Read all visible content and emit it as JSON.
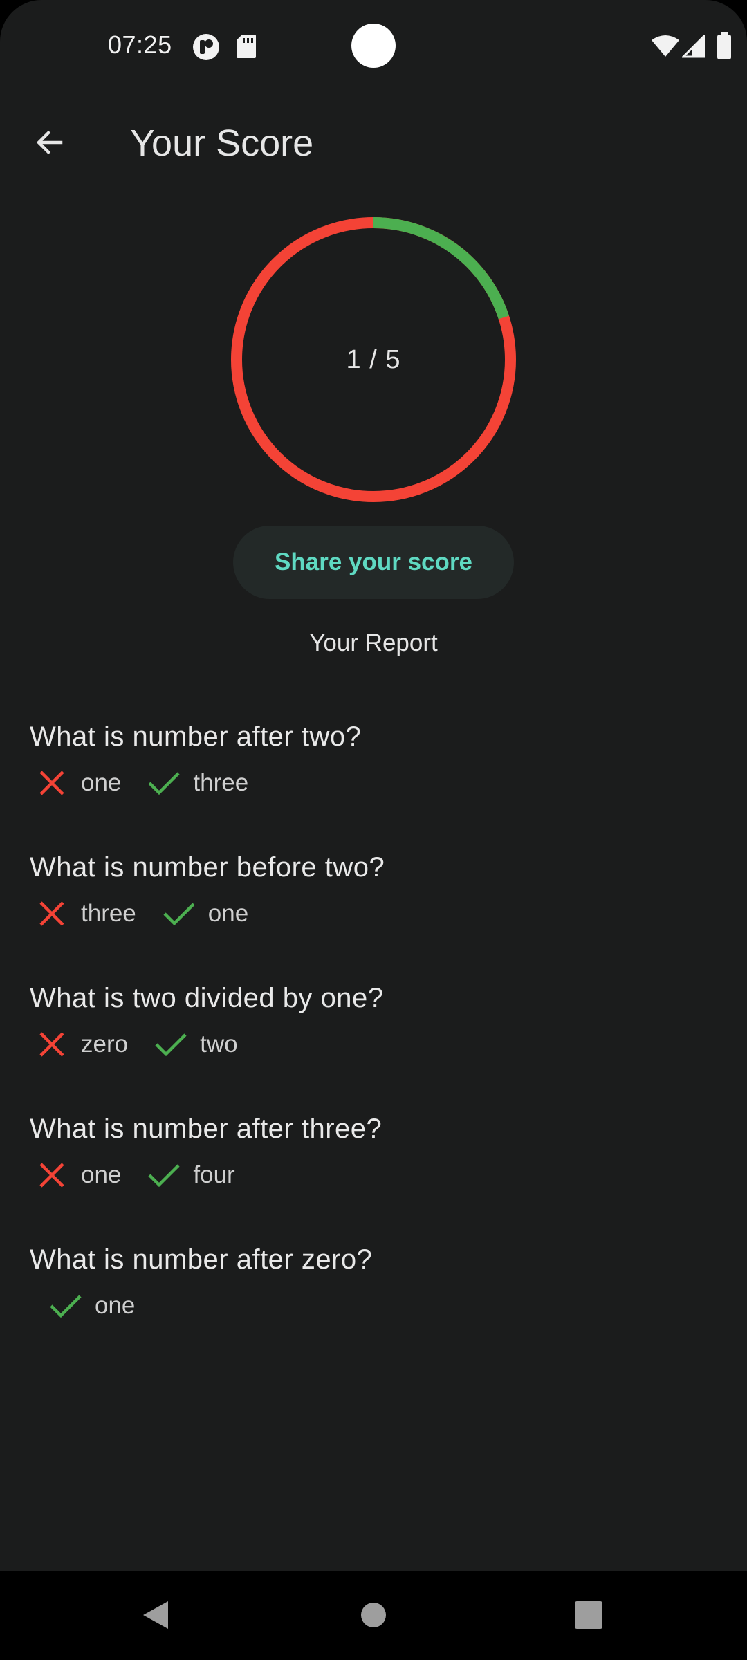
{
  "status_bar": {
    "time": "07:25",
    "left_icons": [
      "media-icon",
      "sd-card-icon"
    ],
    "right_icons": [
      "wifi-icon",
      "cell-signal-icon",
      "battery-icon"
    ]
  },
  "app_bar": {
    "title": "Your Score",
    "back_icon": "arrow-back-icon"
  },
  "score": {
    "text": "1 / 5",
    "correct": 1,
    "total": 5,
    "correct_color": "#4caf50",
    "wrong_color": "#f44336"
  },
  "share_button": {
    "label": "Share your score",
    "color": "#5fd9c2"
  },
  "report": {
    "title": "Your Report",
    "items": [
      {
        "question": "What is number after two?",
        "selected": "one",
        "correct": "three"
      },
      {
        "question": "What is number before two?",
        "selected": "three",
        "correct": "one"
      },
      {
        "question": "What is two divided by one?",
        "selected": "zero",
        "correct": "two"
      },
      {
        "question": "What is number after three?",
        "selected": "one",
        "correct": "four"
      },
      {
        "question": "What is number after zero?",
        "selected": null,
        "correct": "one"
      }
    ]
  },
  "nav_bar": {
    "buttons": [
      "back-triangle-icon",
      "home-circle-icon",
      "recents-square-icon"
    ]
  }
}
